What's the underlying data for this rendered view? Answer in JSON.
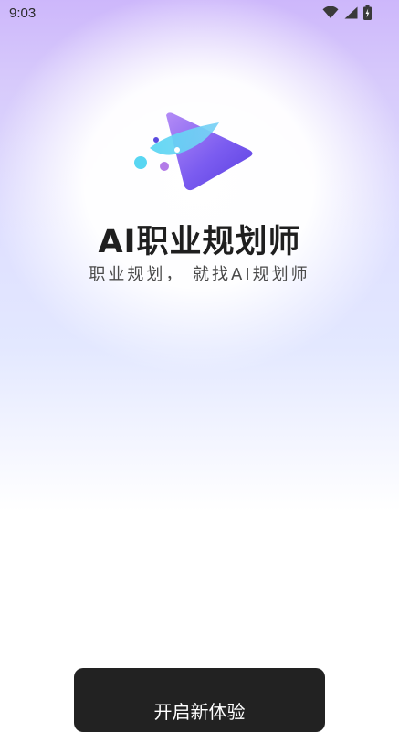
{
  "status_bar": {
    "time": "9:03",
    "icons": [
      "wifi-icon",
      "cell-signal-icon",
      "battery-charging-icon"
    ]
  },
  "app": {
    "logo_icon": "play-triangle-logo",
    "title": "AI职业规划师",
    "subtitle": "职业规划， 就找AI规划师"
  },
  "actions": {
    "start_label": "开启新体验"
  },
  "colors": {
    "accent_purple": "#7b5cf0",
    "accent_cyan": "#58d6f2",
    "button_bg": "#222222"
  }
}
